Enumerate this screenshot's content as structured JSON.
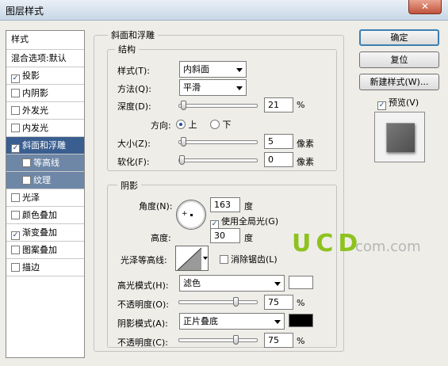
{
  "window": {
    "title": "图层样式",
    "close_label": "✕"
  },
  "styles_list": [
    {
      "label": "样式",
      "type": "header"
    },
    {
      "label": "混合选项:默认",
      "type": "plain"
    },
    {
      "label": "投影",
      "checked": true
    },
    {
      "label": "内阴影",
      "checked": false
    },
    {
      "label": "外发光",
      "checked": false
    },
    {
      "label": "内发光",
      "checked": false
    },
    {
      "label": "斜面和浮雕",
      "checked": true,
      "selected": true
    },
    {
      "label": "等高线",
      "checked": false,
      "sub": true
    },
    {
      "label": "纹理",
      "checked": false,
      "sub": true
    },
    {
      "label": "光泽",
      "checked": false
    },
    {
      "label": "颜色叠加",
      "checked": false
    },
    {
      "label": "渐变叠加",
      "checked": true
    },
    {
      "label": "图案叠加",
      "checked": false
    },
    {
      "label": "描边",
      "checked": false
    }
  ],
  "bevel": {
    "section_title": "斜面和浮雕",
    "structure_title": "结构",
    "style_label": "样式(T):",
    "style_value": "内斜面",
    "method_label": "方法(Q):",
    "method_value": "平滑",
    "depth_label": "深度(D):",
    "depth_value": "21",
    "depth_unit": "%",
    "direction_label": "方向:",
    "dir_up": "上",
    "dir_down": "下",
    "dir_selected": "up",
    "size_label": "大小(Z):",
    "size_value": "5",
    "size_unit": "像素",
    "soften_label": "软化(F):",
    "soften_value": "0",
    "soften_unit": "像素"
  },
  "shading": {
    "title": "阴影",
    "angle_label": "角度(N):",
    "angle_value": "163",
    "angle_unit": "度",
    "global_light_label": "使用全局光(G)",
    "global_light_checked": true,
    "altitude_label": "高度:",
    "altitude_value": "30",
    "altitude_unit": "度",
    "gloss_label": "光泽等高线:",
    "antialias_label": "消除锯齿(L)",
    "antialias_checked": false,
    "highlight_mode_label": "高光模式(H):",
    "highlight_mode_value": "滤色",
    "highlight_color": "#ffffff",
    "highlight_opacity_label": "不透明度(O):",
    "highlight_opacity_value": "75",
    "highlight_opacity_unit": "%",
    "shadow_mode_label": "阴影模式(A):",
    "shadow_mode_value": "正片叠底",
    "shadow_color": "#000000",
    "shadow_opacity_label": "不透明度(C):",
    "shadow_opacity_value": "75",
    "shadow_opacity_unit": "%"
  },
  "slider_levels": {
    "depth": 0.02,
    "size": 0.02,
    "soften": 0.0,
    "highlight_opacity": 0.75,
    "shadow_opacity": 0.75
  },
  "buttons": {
    "ok": "确定",
    "reset": "复位",
    "new_style": "新建样式(W)...",
    "preview": "预览(V)",
    "preview_checked": true
  },
  "watermark": {
    "main": "UCD",
    "suffix": "com.com"
  }
}
